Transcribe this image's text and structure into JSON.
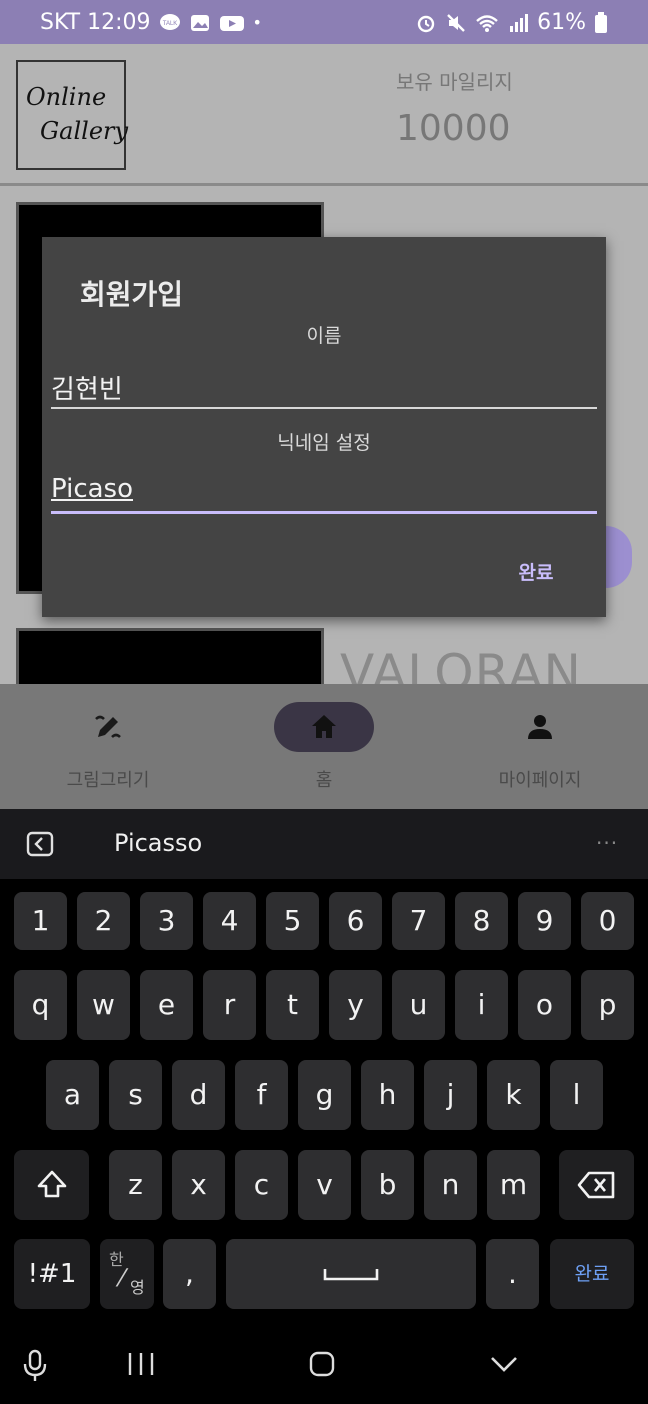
{
  "status_bar": {
    "carrier_time": "SKT 12:09",
    "battery": "61%",
    "dot": "•"
  },
  "app": {
    "logo_line1": "Online",
    "logo_line2": "Gallery",
    "mileage_label": "보유 마일리지",
    "mileage_value": "10000",
    "card_title": "VALORAN"
  },
  "dialog": {
    "title": "회원가입",
    "name_label": "이름",
    "name_value": "김현빈",
    "nickname_label": "닉네임 설정",
    "nickname_value": "Picaso",
    "confirm_label": "완료"
  },
  "bottom_nav": {
    "items": [
      {
        "label": "그림그리기",
        "icon": "draw-icon"
      },
      {
        "label": "홈",
        "icon": "home-icon"
      },
      {
        "label": "마이페이지",
        "icon": "person-icon"
      }
    ]
  },
  "keyboard": {
    "suggestion": "Picasso",
    "more": "···",
    "row_numbers": [
      "1",
      "2",
      "3",
      "4",
      "5",
      "6",
      "7",
      "8",
      "9",
      "0"
    ],
    "row_q": [
      "q",
      "w",
      "e",
      "r",
      "t",
      "y",
      "u",
      "i",
      "o",
      "p"
    ],
    "row_a": [
      "a",
      "s",
      "d",
      "f",
      "g",
      "h",
      "j",
      "k",
      "l"
    ],
    "row_z": [
      "z",
      "x",
      "c",
      "v",
      "b",
      "n",
      "m"
    ],
    "symbols_label": "!#1",
    "lang_top": "한",
    "lang_bottom": "영",
    "comma": ",",
    "period": ".",
    "done_label": "완료",
    "done_color": "#6ea0f5"
  },
  "colors": {
    "status_bar": "#8c7fb4",
    "accent": "#c9bdfb",
    "dialog_bg": "#444444"
  }
}
